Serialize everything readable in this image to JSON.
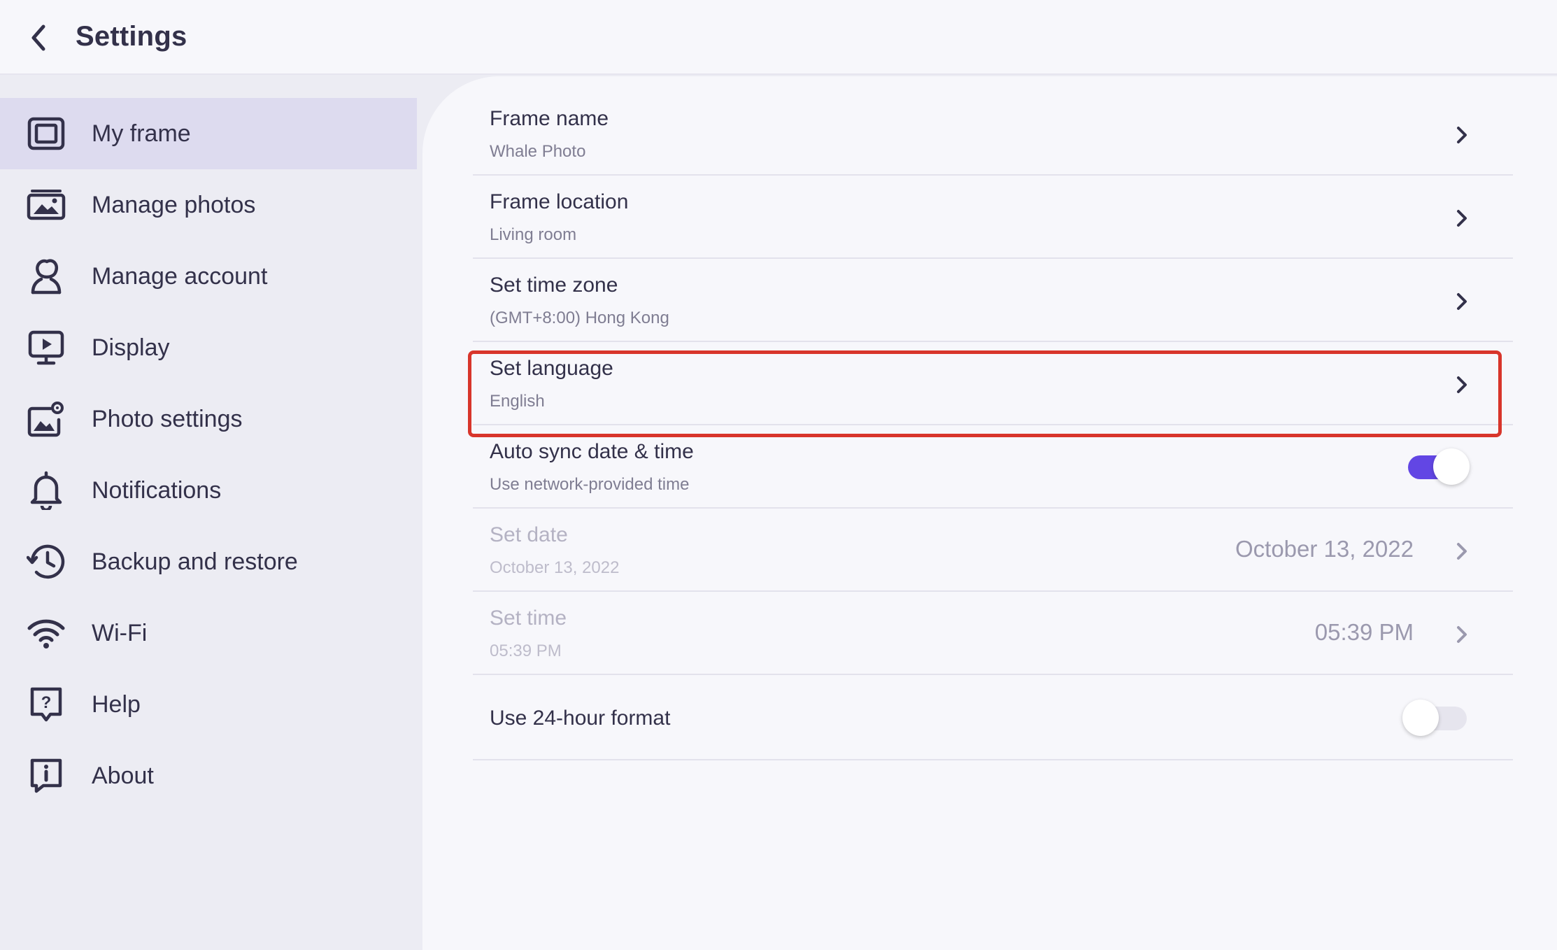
{
  "header": {
    "title": "Settings"
  },
  "sidebar": {
    "items": [
      {
        "label": "My frame",
        "icon": "frame-icon",
        "active": true
      },
      {
        "label": "Manage photos",
        "icon": "photos-icon"
      },
      {
        "label": "Manage account",
        "icon": "account-icon"
      },
      {
        "label": "Display",
        "icon": "display-icon"
      },
      {
        "label": "Photo settings",
        "icon": "photo-settings-icon"
      },
      {
        "label": "Notifications",
        "icon": "bell-icon"
      },
      {
        "label": "Backup and restore",
        "icon": "history-icon"
      },
      {
        "label": "Wi-Fi",
        "icon": "wifi-icon"
      },
      {
        "label": "Help",
        "icon": "help-icon"
      },
      {
        "label": "About",
        "icon": "info-icon"
      }
    ]
  },
  "settings": {
    "frame_name": {
      "title": "Frame name",
      "value": "Whale Photo"
    },
    "frame_location": {
      "title": "Frame location",
      "value": "Living room"
    },
    "time_zone": {
      "title": "Set time zone",
      "value": "(GMT+8:00) Hong Kong"
    },
    "language": {
      "title": "Set language",
      "value": "English"
    },
    "auto_sync": {
      "title": "Auto sync date & time",
      "subtitle": "Use network-provided time",
      "enabled": true
    },
    "date": {
      "title": "Set date",
      "value": "October 13, 2022",
      "display_value": "October 13, 2022",
      "disabled": true
    },
    "time": {
      "title": "Set time",
      "value": "05:39 PM",
      "display_value": "05:39 PM",
      "disabled": true
    },
    "hour24": {
      "title": "Use 24-hour format",
      "enabled": false
    }
  },
  "colors": {
    "accent": "#6246e4",
    "highlight": "#d8352b",
    "sidebar_active": "#dddbef",
    "text": "#33314a"
  }
}
